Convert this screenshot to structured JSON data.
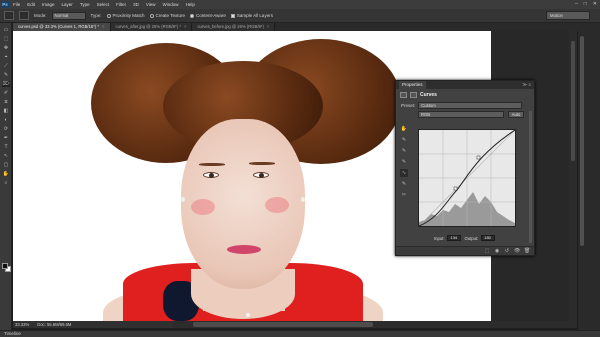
{
  "app": {
    "logo": "Ps"
  },
  "menu": [
    "File",
    "Edit",
    "Image",
    "Layer",
    "Type",
    "Select",
    "Filter",
    "3D",
    "View",
    "Window",
    "Help"
  ],
  "window_controls": [
    "–",
    "□",
    "✕"
  ],
  "options": {
    "mode_label": "Mode:",
    "mode_value": "Normal",
    "type_label": "Type:",
    "radio1": "Proximity Match",
    "radio2": "Create Texture",
    "radio3": "Content-Aware",
    "checkbox": "Sample All Layers",
    "workspace": "Motion"
  },
  "tabs": [
    {
      "label": "curves.psd @ 33.3% (Curves 1, RGB/16*) *",
      "active": true
    },
    {
      "label": "curves_after.jpg @ 25% (RGB/8*) *",
      "active": false
    },
    {
      "label": "curves_before.jpg @ 25% (RGB/8*)",
      "active": false
    }
  ],
  "tab_close": "×",
  "tools": [
    "▭",
    "⬚",
    "✥",
    "⌖",
    "⟋",
    "✎",
    "⌦",
    "✐",
    "⧖",
    "◧",
    "◐",
    "⟳",
    "✒",
    "T",
    "↖",
    "▢",
    "✋",
    "⌕"
  ],
  "status": {
    "zoom": "33.33%",
    "doc": "Doc: 55.6M/69.6M"
  },
  "timeline": "Timeline",
  "properties": {
    "tab": "Properties",
    "controls": "≫ ≡",
    "title": "Curves",
    "preset_label": "Preset:",
    "preset_value": "Custom",
    "channel_value": "RGB",
    "auto_label": "Auto",
    "input_label": "Input:",
    "input_value": "134",
    "output_label": "Output:",
    "output_value": "180",
    "curve_tools": [
      "✋",
      "✎",
      "✎",
      "✎",
      "∿",
      "✎",
      "✂"
    ],
    "foot_icons": [
      "⬚",
      "◉",
      "↺",
      "👁",
      "🗑"
    ]
  }
}
